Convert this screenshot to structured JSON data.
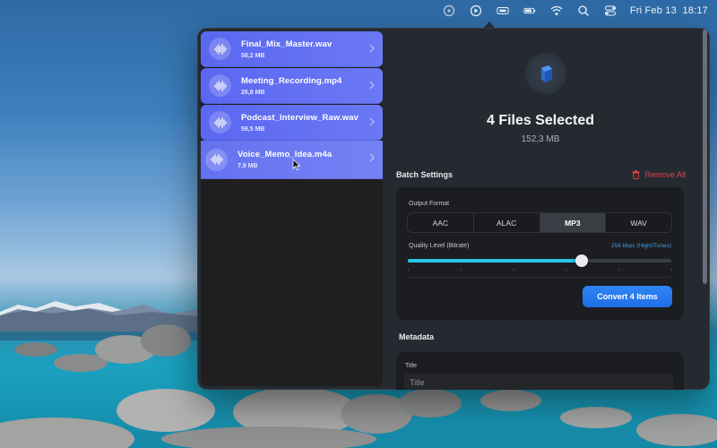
{
  "menubar": {
    "date": "Fri Feb 13",
    "time": "18:17",
    "icons": [
      "app-status-icon",
      "play-icon",
      "media-icon",
      "battery-icon",
      "wifi-icon",
      "search-icon",
      "control-center-icon"
    ]
  },
  "files": [
    {
      "name": "Final_Mix_Master.wav",
      "size": "58,2 MB"
    },
    {
      "name": "Meeting_Recording.mp4",
      "size": "26,8 MB"
    },
    {
      "name": "Podcast_Interview_Raw.wav",
      "size": "59,5 MB"
    },
    {
      "name": "Voice_Memo_Idea.m4a",
      "size": "7,9 MB"
    }
  ],
  "selection": {
    "title": "4 Files Selected",
    "total_size": "152,3 MB"
  },
  "batch": {
    "label": "Batch Settings",
    "remove_all": "Remove All",
    "output_format_label": "Output Format",
    "formats": [
      "AAC",
      "ALAC",
      "MP3",
      "WAV"
    ],
    "selected_format": "MP3",
    "quality_label": "Quality Level (Bitrate)",
    "quality_value": "256 kbps (High/iTunes)",
    "quality_fraction": 0.66,
    "quality_steps": 6,
    "convert_label": "Convert 4 Items"
  },
  "metadata": {
    "label": "Metadata",
    "title_label": "Title",
    "title_placeholder": "Title"
  },
  "colors": {
    "accent": "#1f6ee6",
    "file_item": "#6572f1",
    "slider": "#26c6e8",
    "danger": "#e0424b"
  }
}
